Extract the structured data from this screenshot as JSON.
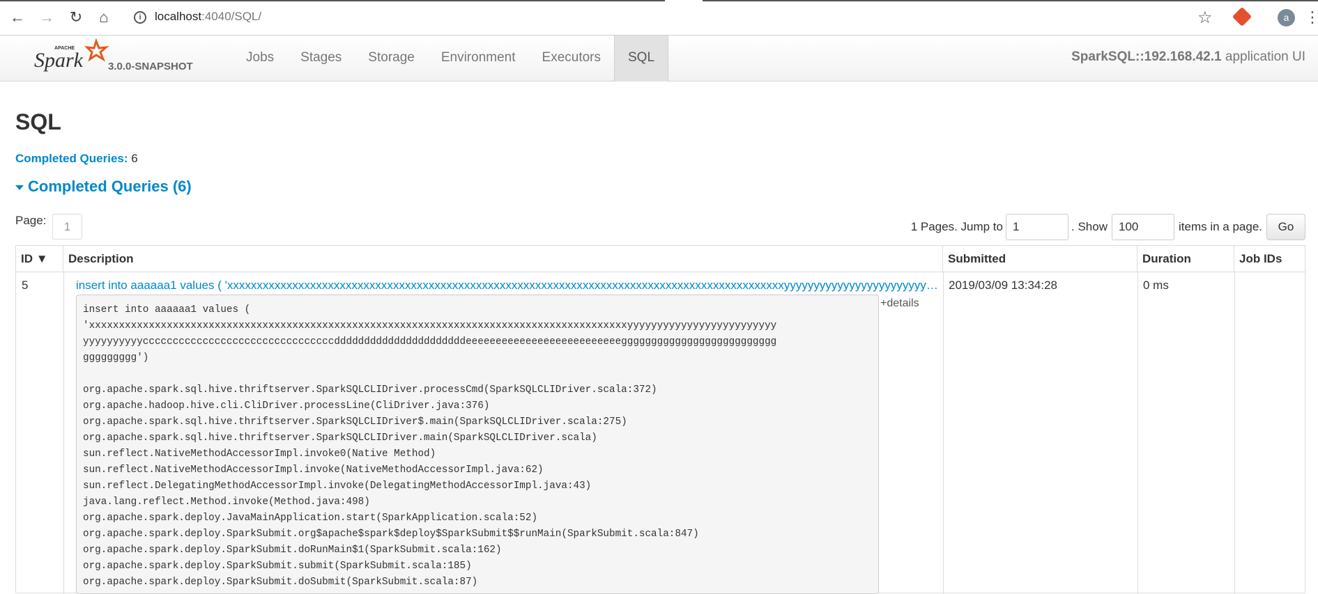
{
  "browser": {
    "url_host": "localhost",
    "url_rest": ":4040/SQL/"
  },
  "spark_nav": {
    "version": "3.0.0-SNAPSHOT",
    "tabs": [
      "Jobs",
      "Stages",
      "Storage",
      "Environment",
      "Executors",
      "SQL"
    ],
    "active_tab": "SQL",
    "app_name": "SparkSQL::192.168.42.1",
    "app_suffix": " application UI"
  },
  "page": {
    "title": "SQL",
    "summary_label": "Completed Queries:",
    "summary_value": " 6",
    "section_title": "Completed Queries (6)"
  },
  "paging": {
    "page_label": "Page:",
    "current_page": "1",
    "pages_text": "1 Pages. Jump to",
    "jump_value": "1",
    "show_text": ". Show",
    "show_value": "100",
    "items_text": "items in a page.",
    "go_label": "Go"
  },
  "table": {
    "headers": [
      "ID ▼",
      "Description",
      "Submitted",
      "Duration",
      "Job IDs"
    ],
    "row": {
      "id": "5",
      "description": "insert into aaaaaa1 values ( 'xxxxxxxxxxxxxxxxxxxxxxxxxxxxxxxxxxxxxxxxxxxxxxxxxxxxxxxxxxxxxxxxxxxxxxxxxxxxxxxxxxxxxxxxxxxxxxyyyyyyyyyyyyyyyyyyyyyyyyyyyyyyyyyyyccccccccccccccccccccccccccccccccc",
      "details_label": "+details",
      "submitted": "2019/03/09 13:34:28",
      "duration": "0 ms",
      "job_ids": "",
      "stack": "insert into aaaaaa1 values (\n'xxxxxxxxxxxxxxxxxxxxxxxxxxxxxxxxxxxxxxxxxxxxxxxxxxxxxxxxxxxxxxxxxxxxxxxxxxxxxxxxxxxxxxxxxxyyyyyyyyyyyyyyyyyyyyyyyyy\nyyyyyyyyyyccccccccccccccccccccccccccccccccddddddddddddddddddddddeeeeeeeeeeeeeeeeeeeeeeeeeegggggggggggggggggggggggggg\nggggggggg')\n\norg.apache.spark.sql.hive.thriftserver.SparkSQLCLIDriver.processCmd(SparkSQLCLIDriver.scala:372)\norg.apache.hadoop.hive.cli.CliDriver.processLine(CliDriver.java:376)\norg.apache.spark.sql.hive.thriftserver.SparkSQLCLIDriver$.main(SparkSQLCLIDriver.scala:275)\norg.apache.spark.sql.hive.thriftserver.SparkSQLCLIDriver.main(SparkSQLCLIDriver.scala)\nsun.reflect.NativeMethodAccessorImpl.invoke0(Native Method)\nsun.reflect.NativeMethodAccessorImpl.invoke(NativeMethodAccessorImpl.java:62)\nsun.reflect.DelegatingMethodAccessorImpl.invoke(DelegatingMethodAccessorImpl.java:43)\njava.lang.reflect.Method.invoke(Method.java:498)\norg.apache.spark.deploy.JavaMainApplication.start(SparkApplication.scala:52)\norg.apache.spark.deploy.SparkSubmit.org$apache$spark$deploy$SparkSubmit$$runMain(SparkSubmit.scala:847)\norg.apache.spark.deploy.SparkSubmit.doRunMain$1(SparkSubmit.scala:162)\norg.apache.spark.deploy.SparkSubmit.submit(SparkSubmit.scala:185)\norg.apache.spark.deploy.SparkSubmit.doSubmit(SparkSubmit.scala:87)"
    }
  },
  "colors": {
    "link": "#0088cc",
    "logo_orange": "#e25a1c"
  }
}
